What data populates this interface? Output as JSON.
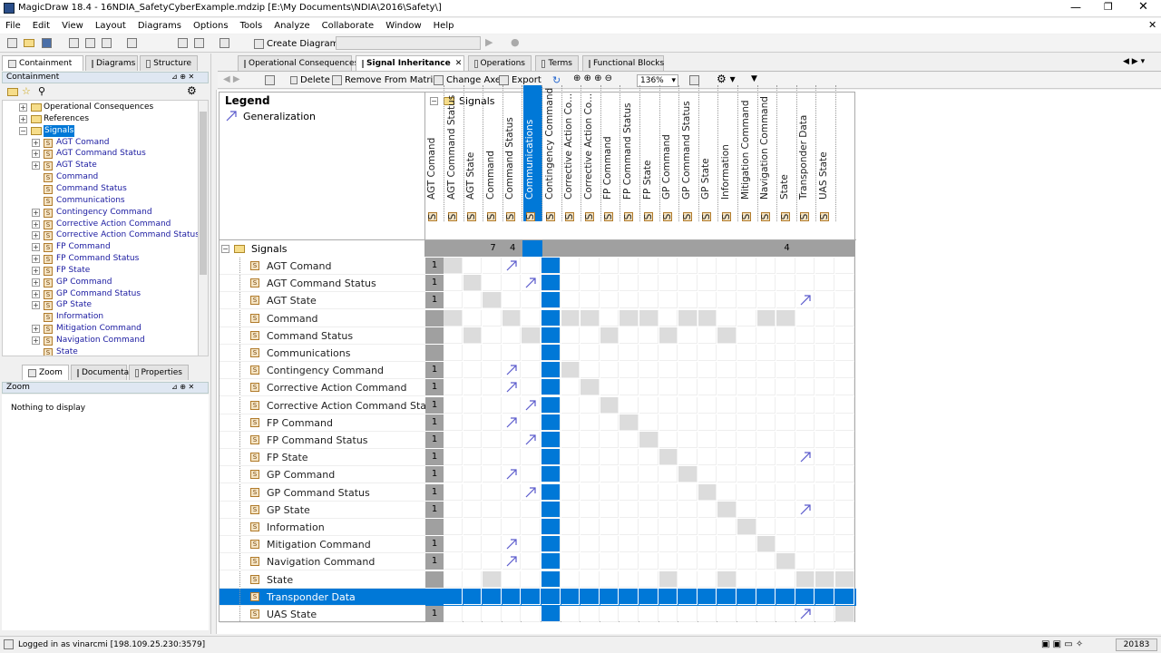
{
  "window": {
    "title": "MagicDraw 18.4 - 16NDIA_SafetyCyberExample.mdzip [E:\\My Documents\\NDIA\\2016\\Safety\\]"
  },
  "menu": [
    "File",
    "Edit",
    "View",
    "Layout",
    "Diagrams",
    "Options",
    "Tools",
    "Analyze",
    "Collaborate",
    "Window",
    "Help"
  ],
  "toolbar": {
    "create_diagram": "Create Diagram"
  },
  "left_tabs": [
    "Containment",
    "Diagrams",
    "Structure"
  ],
  "containment": {
    "title": "Containment",
    "tree": [
      {
        "label": "Operational Consequences",
        "kind": "folder",
        "indent": 1,
        "exp": "+"
      },
      {
        "label": "References",
        "kind": "folder",
        "indent": 1,
        "exp": "+"
      },
      {
        "label": "Signals",
        "kind": "folder",
        "indent": 1,
        "exp": "-",
        "selected": true
      },
      {
        "label": "AGT Comand",
        "kind": "sig",
        "indent": 2,
        "exp": "+"
      },
      {
        "label": "AGT Command Status",
        "kind": "sig",
        "indent": 2,
        "exp": "+"
      },
      {
        "label": "AGT State",
        "kind": "sig",
        "indent": 2,
        "exp": "+"
      },
      {
        "label": "Command",
        "kind": "sig",
        "indent": 2,
        "exp": ""
      },
      {
        "label": "Command Status",
        "kind": "sig",
        "indent": 2,
        "exp": ""
      },
      {
        "label": "Communications",
        "kind": "sig",
        "indent": 2,
        "exp": ""
      },
      {
        "label": "Contingency Command",
        "kind": "sig",
        "indent": 2,
        "exp": "+"
      },
      {
        "label": "Corrective Action Command",
        "kind": "sig",
        "indent": 2,
        "exp": "+"
      },
      {
        "label": "Corrective Action Command Status",
        "kind": "sig",
        "indent": 2,
        "exp": "+"
      },
      {
        "label": "FP Command",
        "kind": "sig",
        "indent": 2,
        "exp": "+"
      },
      {
        "label": "FP Command Status",
        "kind": "sig",
        "indent": 2,
        "exp": "+"
      },
      {
        "label": "FP State",
        "kind": "sig",
        "indent": 2,
        "exp": "+"
      },
      {
        "label": "GP Command",
        "kind": "sig",
        "indent": 2,
        "exp": "+"
      },
      {
        "label": "GP Command Status",
        "kind": "sig",
        "indent": 2,
        "exp": "+"
      },
      {
        "label": "GP State",
        "kind": "sig",
        "indent": 2,
        "exp": "+"
      },
      {
        "label": "Information",
        "kind": "sig",
        "indent": 2,
        "exp": ""
      },
      {
        "label": "Mitigation Command",
        "kind": "sig",
        "indent": 2,
        "exp": "+"
      },
      {
        "label": "Navigation Command",
        "kind": "sig",
        "indent": 2,
        "exp": "+"
      },
      {
        "label": "State",
        "kind": "sig",
        "indent": 2,
        "exp": ""
      }
    ]
  },
  "bottom_tabs": [
    "Zoom",
    "Documenta...",
    "Properties"
  ],
  "zoom": {
    "title": "Zoom",
    "empty": "Nothing to display"
  },
  "diagram_tabs": [
    "Operational Consequences",
    "Signal Inheritance",
    "Operations",
    "Terms",
    "Functional Blocks"
  ],
  "diagram_toolbar": {
    "delete": "Delete",
    "remove": "Remove From Matrix",
    "change_axes": "Change Axes",
    "export": "Export",
    "zoom": "136%"
  },
  "legend": {
    "title": "Legend",
    "item": "Generalization"
  },
  "matrix": {
    "group": "Signals",
    "columns": [
      "AGT Comand",
      "AGT Command Status",
      "AGT State",
      "Command",
      "Command Status",
      "Communications",
      "Contingency Command",
      "Corrective Action Co...",
      "Corrective Action Co...",
      "FP Command",
      "FP Command Status",
      "FP State",
      "GP Command",
      "GP Command Status",
      "GP State",
      "Information",
      "Mitigation Command",
      "Navigation Command",
      "State",
      "Transponder Data",
      "UAS State"
    ],
    "col_totals": [
      "",
      "",
      "",
      "7",
      "4",
      "",
      "",
      "",
      "",
      "",
      "",
      "",
      "",
      "",
      "",
      "",
      "",
      "",
      "4",
      "",
      ""
    ],
    "rows": [
      {
        "label": "AGT Comand",
        "count": "1",
        "arrow": 3
      },
      {
        "label": "AGT Command Status",
        "count": "1",
        "arrow": 4
      },
      {
        "label": "AGT State",
        "count": "1",
        "arrow": 18
      },
      {
        "label": "Command",
        "count": "",
        "arrow": -1
      },
      {
        "label": "Command Status",
        "count": "",
        "arrow": -1
      },
      {
        "label": "Communications",
        "count": "",
        "arrow": -1
      },
      {
        "label": "Contingency Command",
        "count": "1",
        "arrow": 3
      },
      {
        "label": "Corrective Action Command",
        "count": "1",
        "arrow": 3
      },
      {
        "label": "Corrective Action Command Status",
        "count": "1",
        "arrow": 4
      },
      {
        "label": "FP Command",
        "count": "1",
        "arrow": 3
      },
      {
        "label": "FP Command Status",
        "count": "1",
        "arrow": 4
      },
      {
        "label": "FP State",
        "count": "1",
        "arrow": 18
      },
      {
        "label": "GP Command",
        "count": "1",
        "arrow": 3
      },
      {
        "label": "GP Command Status",
        "count": "1",
        "arrow": 4
      },
      {
        "label": "GP State",
        "count": "1",
        "arrow": 18
      },
      {
        "label": "Information",
        "count": "",
        "arrow": -1
      },
      {
        "label": "Mitigation Command",
        "count": "1",
        "arrow": 3
      },
      {
        "label": "Navigation Command",
        "count": "1",
        "arrow": 3
      },
      {
        "label": "State",
        "count": "",
        "arrow": -1
      },
      {
        "label": "Transponder Data",
        "count": "",
        "arrow": -1
      },
      {
        "label": "UAS State",
        "count": "1",
        "arrow": 18
      }
    ]
  },
  "status": {
    "login": "Logged in as vinarcmi [198.109.25.230:3579]",
    "mem": "20183"
  },
  "colors": {
    "selection": "#0078d7",
    "diag": "#dcdcdc",
    "header": "#a0a0a0",
    "arrow": "#5a5acc"
  }
}
